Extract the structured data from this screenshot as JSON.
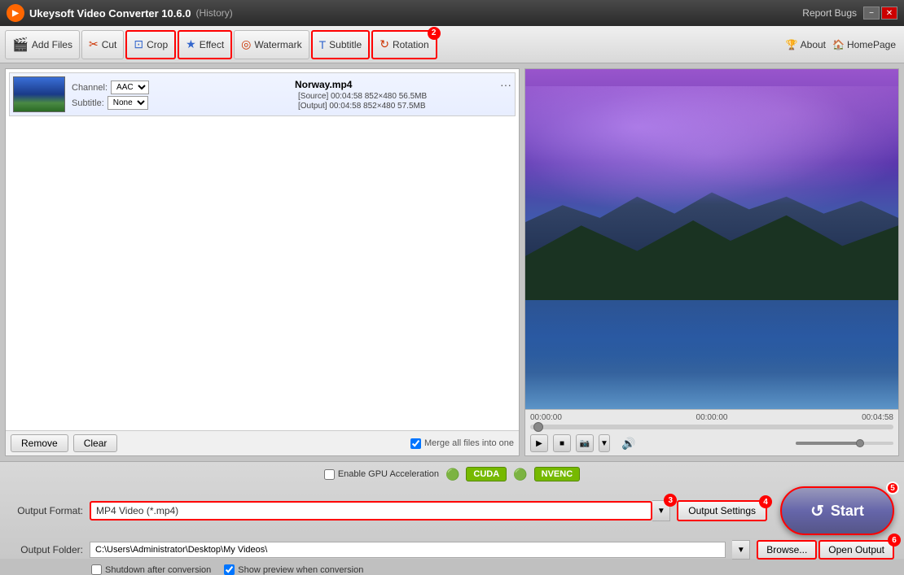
{
  "titlebar": {
    "app_icon": "▶",
    "app_title": "Ukeysoft Video Converter 10.6.0",
    "history_label": "(History)",
    "report_bugs": "Report Bugs",
    "minimize_label": "−",
    "close_label": "✕"
  },
  "toolbar": {
    "add_files_label": "Add Files",
    "cut_label": "Cut",
    "crop_label": "Crop",
    "effect_label": "Effect",
    "watermark_label": "Watermark",
    "subtitle_label": "Subtitle",
    "rotation_label": "Rotation",
    "rotation_badge": "2",
    "about_label": "About",
    "homepage_label": "HomePage"
  },
  "file_list": {
    "file_name": "Norway.mp4",
    "channel_label": "Channel:",
    "channel_value": "AAC",
    "subtitle_label": "Subtitle:",
    "subtitle_value": "None",
    "source_info": "[Source]  00:04:58  852×480  56.5MB",
    "output_info": "[Output]  00:04:58  852×480  57.5MB",
    "remove_btn": "Remove",
    "clear_btn": "Clear",
    "merge_label": "Merge all files into one"
  },
  "preview": {
    "time_current": "00:00:00",
    "time_middle": "00:00:00",
    "time_total": "00:04:58",
    "play_icon": "▶",
    "stop_icon": "■",
    "camera_icon": "📷",
    "volume_icon": "🔊"
  },
  "bottom": {
    "gpu_acceleration_label": "Enable GPU Acceleration",
    "cuda_label": "CUDA",
    "nvenc_label": "NVENC",
    "output_format_label": "Output Format:",
    "output_format_value": "MP4 Video (*.mp4)",
    "format_badge": "3",
    "output_settings_label": "Output Settings",
    "settings_badge": "4",
    "output_folder_label": "Output Folder:",
    "output_folder_value": "C:\\Users\\Administrator\\Desktop\\My Videos\\",
    "browse_label": "Browse...",
    "open_output_label": "Open Output",
    "folder_badge": "6",
    "shutdown_label": "Shutdown after conversion",
    "preview_label": "Show preview when conversion",
    "start_label": "Start",
    "start_badge": "5"
  }
}
